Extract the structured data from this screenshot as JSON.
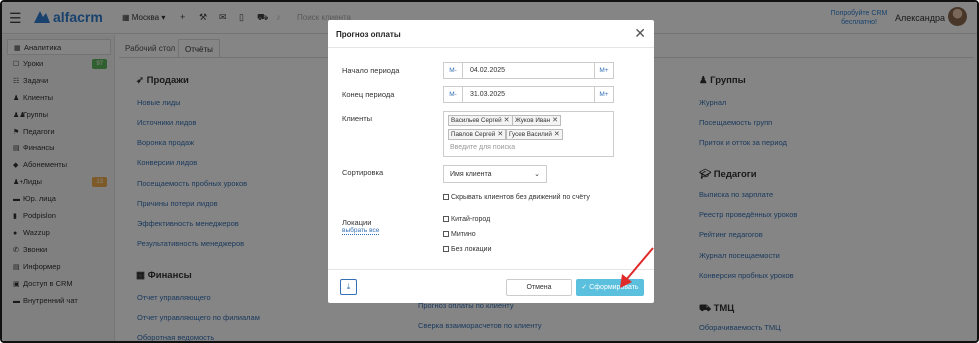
{
  "colors": {
    "brand": "#2f7fd1",
    "link": "#3470b3",
    "submit": "#5bc0de",
    "annotation_arrow": "#e02a2a",
    "badge_green": "#5cb85c",
    "badge_orange": "#f0ad4e"
  },
  "topbar": {
    "logo": "alfacrm",
    "branch": "Москва",
    "search_placeholder": "Поиск клиента",
    "promo": "Попробуйте CRM бесплатно!",
    "user_name": "Александра",
    "icons": [
      "menu-icon",
      "plus-icon",
      "wrench-icon",
      "mail-icon",
      "mobile-icon",
      "cart-icon",
      "bell-icon"
    ]
  },
  "sidebar": {
    "items": [
      {
        "label": "Аналитика",
        "icon": "chart-icon",
        "active": true
      },
      {
        "label": "Уроки",
        "icon": "square-icon",
        "badge": "97",
        "badge_color": "#5cb85c"
      },
      {
        "label": "Задачи",
        "icon": "tasks-icon"
      },
      {
        "label": "Клиенты",
        "icon": "user-icon"
      },
      {
        "label": "Группы",
        "icon": "users-icon"
      },
      {
        "label": "Педагоги",
        "icon": "graduation-icon"
      },
      {
        "label": "Финансы",
        "icon": "money-icon"
      },
      {
        "label": "Абонементы",
        "icon": "tag-icon"
      },
      {
        "label": "Лиды",
        "icon": "user-plus-icon",
        "badge": "13",
        "badge_color": "#f0ad4e"
      },
      {
        "label": "Юр. лица",
        "icon": "briefcase-icon"
      },
      {
        "label": "Podpislon",
        "icon": "file-icon"
      },
      {
        "label": "Wazzup",
        "icon": "whatsapp-icon"
      },
      {
        "label": "Звонки",
        "icon": "phone-icon"
      },
      {
        "label": "Информер",
        "icon": "newspaper-icon"
      },
      {
        "label": "Доступ в CRM",
        "icon": "lock-icon"
      },
      {
        "label": "Внутренний чат",
        "icon": "chat-icon"
      }
    ]
  },
  "tabs": [
    {
      "label": "Рабочий стол"
    },
    {
      "label": "Отчёты",
      "active": true
    }
  ],
  "sections": {
    "sales": {
      "title": "Продажи",
      "links": [
        "Новые лиды",
        "Источники лидов",
        "Воронка продаж",
        "Конверсии лидов",
        "Посещаемость пробных уроков",
        "Причины потери лидов",
        "Эффективность менеджеров",
        "Результативность менеджеров"
      ]
    },
    "finance": {
      "title": "Финансы",
      "links": [
        "Отчет управляющего",
        "Отчет управляющего по филиалам",
        "Оборотная ведомость"
      ]
    },
    "middle": {
      "links": [
        "Прогноз оплаты по клиенту",
        "Сверка взаиморасчетов по клиенту"
      ]
    },
    "groups": {
      "title": "Группы",
      "links": [
        "Журнал",
        "Посещаемость групп",
        "Приток и отток за период"
      ]
    },
    "teachers": {
      "title": "Педагоги",
      "links": [
        "Выписка по зарплате",
        "Реестр проведённых уроков",
        "Рейтинг педагогов",
        "Журнал посещаемости",
        "Конверсия пробных уроков"
      ]
    },
    "tmc": {
      "title": "ТМЦ",
      "links": [
        "Оборачиваемость ТМЦ"
      ]
    }
  },
  "modal": {
    "title": "Прогноз оплаты",
    "period_start_label": "Начало периода",
    "period_start": "04.02.2025",
    "period_end_label": "Конец периода",
    "period_end": "31.03.2025",
    "minus_label": "M-",
    "plus_label": "M+",
    "clients_label": "Клиенты",
    "clients": [
      "Васильев Сергей",
      "Жуков Иван",
      "Павлов Сергей",
      "Гусев Василий"
    ],
    "clients_placeholder": "Введите для поиска",
    "sort_label": "Сортировка",
    "sort_value": "Имя клиента",
    "hide_inactive_label": "Скрывать клиентов без движений по счёту",
    "locations_label": "Локации",
    "select_all": "выбрать все",
    "locations": [
      "Китай-город",
      "Митино",
      "Без локации"
    ],
    "cancel_label": "Отмена",
    "submit_label": "Сформировать"
  }
}
